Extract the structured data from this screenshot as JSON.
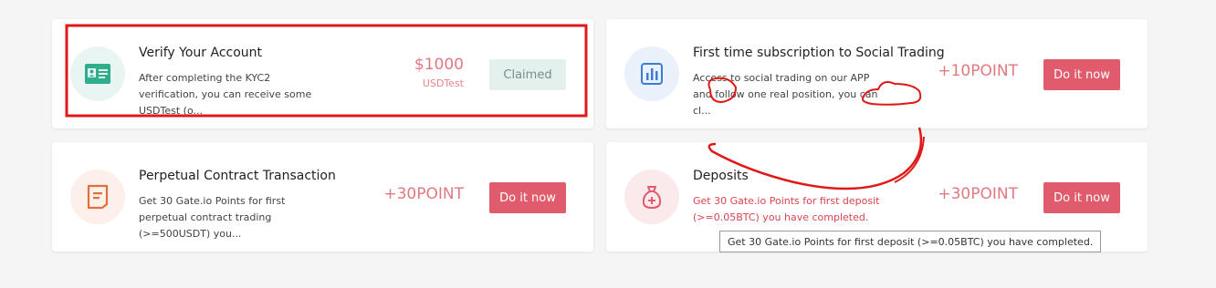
{
  "cards": {
    "verify": {
      "title": "Verify Your Account",
      "desc": "After completing the KYC2 verification, you can receive some USDTest (o...",
      "reward": "$1000",
      "reward_unit": "USDTest",
      "button": "Claimed",
      "icon": "id-card-icon"
    },
    "social": {
      "title": "First time subscription to Social Trading",
      "desc": "Access to social trading on our APP and follow one real position, you can cl...",
      "reward": "+10POINT",
      "button": "Do it now",
      "icon": "bar-chart-icon"
    },
    "perp": {
      "title": "Perpetual Contract Transaction",
      "desc": "Get 30 Gate.io Points for first perpetual contract trading (>=500USDT) you...",
      "reward": "+30POINT",
      "button": "Do it now",
      "icon": "document-icon"
    },
    "dep": {
      "title": "Deposits",
      "desc": "Get 30 Gate.io Points for first deposit (>=0.05BTC) you have completed.",
      "reward": "+30POINT",
      "button": "Do it now",
      "icon": "money-bag-icon"
    }
  },
  "tooltip": "Get 30 Gate.io Points for first deposit (>=0.05BTC) you have completed.",
  "colors": {
    "accent_red": "#e05b6b",
    "claimed_bg": "#e3f0ee",
    "annotation_red": "#e01818"
  }
}
